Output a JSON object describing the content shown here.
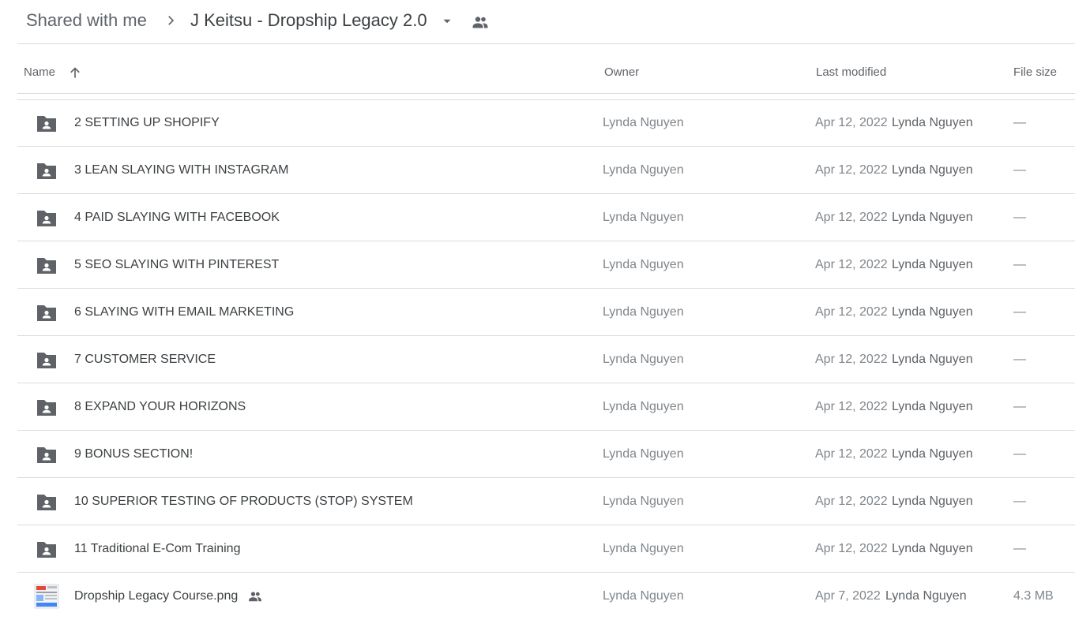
{
  "breadcrumb": {
    "root": "Shared with me",
    "current": "J Keitsu - Dropship Legacy 2.0",
    "separator_icon": "chevron-right-icon",
    "dropdown_icon": "caret-down-icon",
    "shared_icon": "people-icon"
  },
  "columns": {
    "name": "Name",
    "owner": "Owner",
    "last_modified": "Last modified",
    "file_size": "File size",
    "sort_icon": "arrow-up-icon"
  },
  "rows": [
    {
      "name": "2 SETTING UP SHOPIFY",
      "owner": "Lynda Nguyen",
      "date": "Apr 12, 2022",
      "modifier": "Lynda Nguyen",
      "size": "—",
      "icon": "shared-folder-icon"
    },
    {
      "name": "3 LEAN SLAYING WITH INSTAGRAM",
      "owner": "Lynda Nguyen",
      "date": "Apr 12, 2022",
      "modifier": "Lynda Nguyen",
      "size": "—",
      "icon": "shared-folder-icon"
    },
    {
      "name": "4 PAID SLAYING WITH FACEBOOK",
      "owner": "Lynda Nguyen",
      "date": "Apr 12, 2022",
      "modifier": "Lynda Nguyen",
      "size": "—",
      "icon": "shared-folder-icon"
    },
    {
      "name": "5 SEO SLAYING WITH PINTEREST",
      "owner": "Lynda Nguyen",
      "date": "Apr 12, 2022",
      "modifier": "Lynda Nguyen",
      "size": "—",
      "icon": "shared-folder-icon"
    },
    {
      "name": "6 SLAYING WITH EMAIL MARKETING",
      "owner": "Lynda Nguyen",
      "date": "Apr 12, 2022",
      "modifier": "Lynda Nguyen",
      "size": "—",
      "icon": "shared-folder-icon"
    },
    {
      "name": "7 CUSTOMER SERVICE",
      "owner": "Lynda Nguyen",
      "date": "Apr 12, 2022",
      "modifier": "Lynda Nguyen",
      "size": "—",
      "icon": "shared-folder-icon"
    },
    {
      "name": "8 EXPAND YOUR HORIZONS",
      "owner": "Lynda Nguyen",
      "date": "Apr 12, 2022",
      "modifier": "Lynda Nguyen",
      "size": "—",
      "icon": "shared-folder-icon"
    },
    {
      "name": "9 BONUS SECTION!",
      "owner": "Lynda Nguyen",
      "date": "Apr 12, 2022",
      "modifier": "Lynda Nguyen",
      "size": "—",
      "icon": "shared-folder-icon"
    },
    {
      "name": "10 SUPERIOR TESTING OF PRODUCTS (STOP) SYSTEM",
      "owner": "Lynda Nguyen",
      "date": "Apr 12, 2022",
      "modifier": "Lynda Nguyen",
      "size": "—",
      "icon": "shared-folder-icon"
    },
    {
      "name": "11 Traditional E-Com Training",
      "owner": "Lynda Nguyen",
      "date": "Apr 12, 2022",
      "modifier": "Lynda Nguyen",
      "size": "—",
      "icon": "shared-folder-icon"
    },
    {
      "name": "Dropship Legacy Course.png",
      "owner": "Lynda Nguyen",
      "date": "Apr 7, 2022",
      "modifier": "Lynda Nguyen",
      "size": "4.3 MB",
      "icon": "image-thumbnail-icon",
      "shared_icon": "people-icon"
    }
  ],
  "colors": {
    "text_primary": "#3c4043",
    "text_secondary": "#5f6368",
    "text_muted": "#80868b",
    "divider": "#dadce0",
    "folder_icon": "#5f6368"
  }
}
